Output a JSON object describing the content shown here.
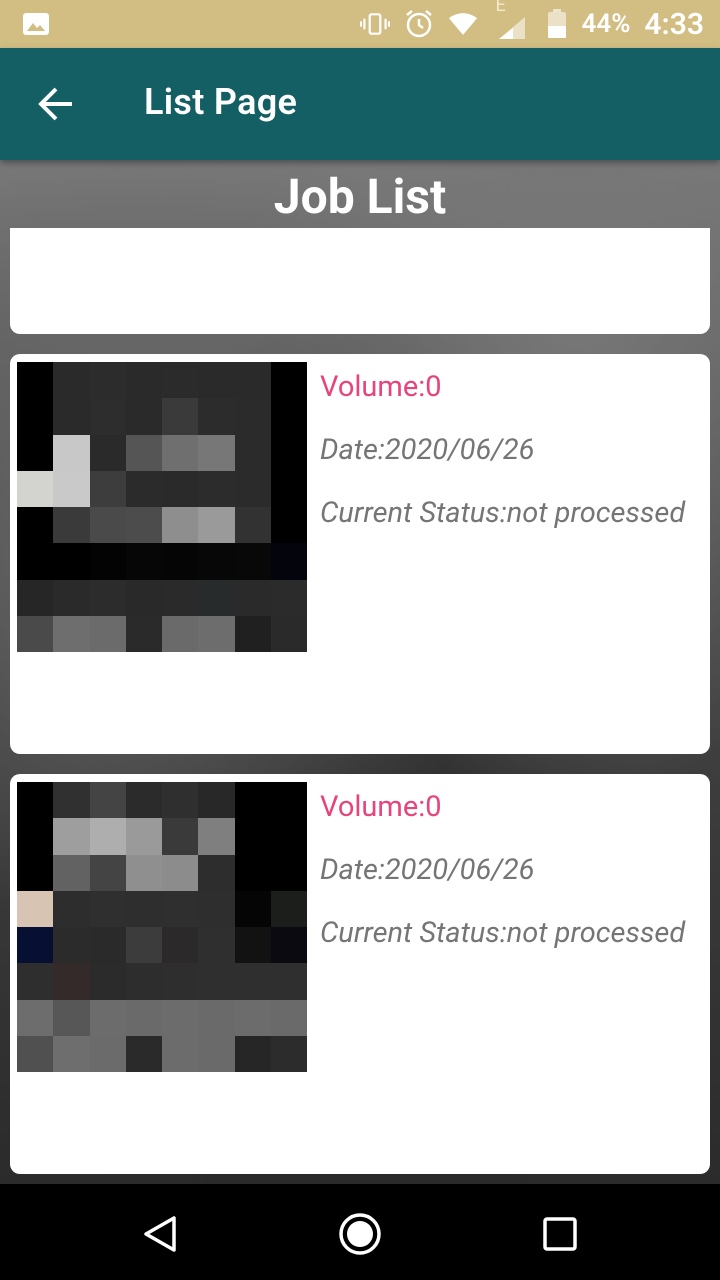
{
  "status_bar": {
    "battery_percent": "44%",
    "time": "4:33",
    "network_type": "E",
    "icons": [
      "image-icon",
      "vibrate-icon",
      "alarm-icon",
      "wifi-icon",
      "signal-icon",
      "battery-icon"
    ]
  },
  "app_bar": {
    "title": "List Page",
    "back_icon": "arrow-left-icon"
  },
  "page": {
    "heading": "Job List"
  },
  "jobs": [
    {
      "volume": "Volume:0",
      "date": "Date:2020/06/26",
      "status": "Current Status:not processed",
      "thumbnail": [
        "#000000",
        "#2a2a2a",
        "#2c2c2c",
        "#2a2a2a",
        "#2b2b2b",
        "#2a2a2a",
        "#2a2a2a",
        "#000000",
        "#000000",
        "#2a2a2a",
        "#2d2d2d",
        "#2a2a2a",
        "#3a3a3a",
        "#2c2c2c",
        "#2b2b2b",
        "#000000",
        "#000000",
        "#c8c8c8",
        "#2a2a2a",
        "#555555",
        "#6f6f6f",
        "#777777",
        "#2b2b2b",
        "#000000",
        "#d3d3d0",
        "#c9c9c9",
        "#3d3d3d",
        "#2b2b2b",
        "#2a2a2a",
        "#2c2c2c",
        "#2b2b2b",
        "#000000",
        "#000000",
        "#3a3a3a",
        "#4a4a4a",
        "#4c4c4c",
        "#8e8e8e",
        "#9a9a9a",
        "#323232",
        "#000000",
        "#000000",
        "#000000",
        "#030303",
        "#060606",
        "#050505",
        "#070707",
        "#080808",
        "#04040c",
        "#262626",
        "#2a2a2a",
        "#2c2c2c",
        "#292929",
        "#2a2a2a",
        "#272b2b",
        "#2a2a2a",
        "#2b2b2b",
        "#4a4a4a",
        "#6e6e6e",
        "#6b6b6b",
        "#2a2a2a",
        "#6a6a6a",
        "#6d6d6d",
        "#202020",
        "#2a2a2a"
      ]
    },
    {
      "volume": "Volume:0",
      "date": "Date:2020/06/26",
      "status": "Current Status:not processed",
      "thumbnail": [
        "#000000",
        "#303030",
        "#444444",
        "#2b2b2b",
        "#2f2f2f",
        "#282828",
        "#000000",
        "#000000",
        "#000000",
        "#9e9e9e",
        "#aeaeae",
        "#9a9a9a",
        "#3a3a3a",
        "#7f7f7f",
        "#000000",
        "#000000",
        "#000000",
        "#626262",
        "#444444",
        "#8f8f8f",
        "#8c8c8c",
        "#2d2d2d",
        "#000000",
        "#000000",
        "#d7c4b2",
        "#2d2d2d",
        "#2f2f2f",
        "#2e2e2e",
        "#2f2f2f",
        "#2e2e2e",
        "#050505",
        "#1c1e1c",
        "#071033",
        "#2b2b2b",
        "#2a2a2a",
        "#3c3c3c",
        "#2b2929",
        "#2f2f2f",
        "#121212",
        "#0a0a10",
        "#2e2e2e",
        "#342a2a",
        "#2b2b2b",
        "#2d2d2d",
        "#2e2e2e",
        "#2f2f2f",
        "#2f2f2f",
        "#2f2f2f",
        "#6d6d6d",
        "#575757",
        "#6c6c6c",
        "#6a6a6a",
        "#6c6c6c",
        "#6a6a6a",
        "#6c6c6c",
        "#6a6a6a",
        "#505050",
        "#6e6e6e",
        "#6b6b6b",
        "#2a2a2a",
        "#6c6c6c",
        "#6a6a6a",
        "#262626",
        "#2c2c2c"
      ]
    }
  ],
  "colors": {
    "status_bar_bg": "#d2bd83",
    "app_bar_bg": "#135f63",
    "volume_text": "#e8437a",
    "secondary_text": "#757575",
    "card_bg": "#ffffff"
  },
  "nav_bar": {
    "icons": [
      "nav-back-icon",
      "nav-home-icon",
      "nav-recent-icon"
    ]
  }
}
